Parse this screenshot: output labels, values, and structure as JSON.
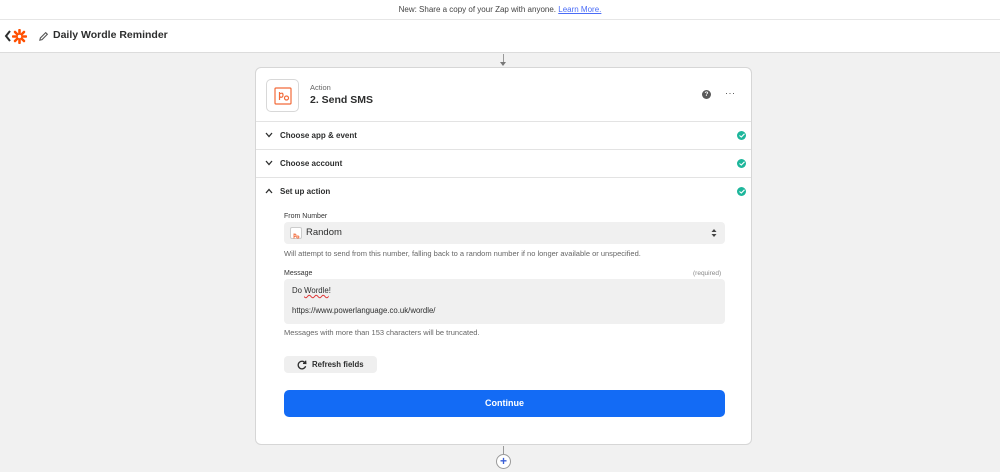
{
  "banner": {
    "text": "New: Share a copy of your Zap with anyone.",
    "link": "Learn More."
  },
  "header": {
    "title": "Daily Wordle Reminder",
    "icons": {
      "back": "chevron-left-icon",
      "logo": "zapier-logo-icon",
      "edit": "pencil-icon"
    }
  },
  "step": {
    "kind": "Action",
    "title": "2. Send SMS",
    "help": "?",
    "more": "···"
  },
  "sections": [
    {
      "label": "Choose app & event",
      "expanded": false,
      "complete": true
    },
    {
      "label": "Choose account",
      "expanded": false,
      "complete": true
    },
    {
      "label": "Set up action",
      "expanded": true,
      "complete": true
    }
  ],
  "form": {
    "from_number": {
      "label": "From Number",
      "value": "Random",
      "help": "Will attempt to send from this number, falling back to a random number if no longer available or unspecified."
    },
    "message": {
      "label": "Message",
      "required": "(required)",
      "line1_prefix": "Do ",
      "line1_word": "Wordle",
      "line1_suffix": "!",
      "line2": "https://www.powerlanguage.co.uk/wordle/",
      "help": "Messages with more than 153 characters will be truncated."
    },
    "refresh_label": "Refresh fields",
    "continue_label": "Continue"
  },
  "add_step": "+",
  "colors": {
    "accent": "#136bf5",
    "success": "#1db69b",
    "brand": "#ff4f00",
    "sms_icon": "#f26b3a"
  }
}
